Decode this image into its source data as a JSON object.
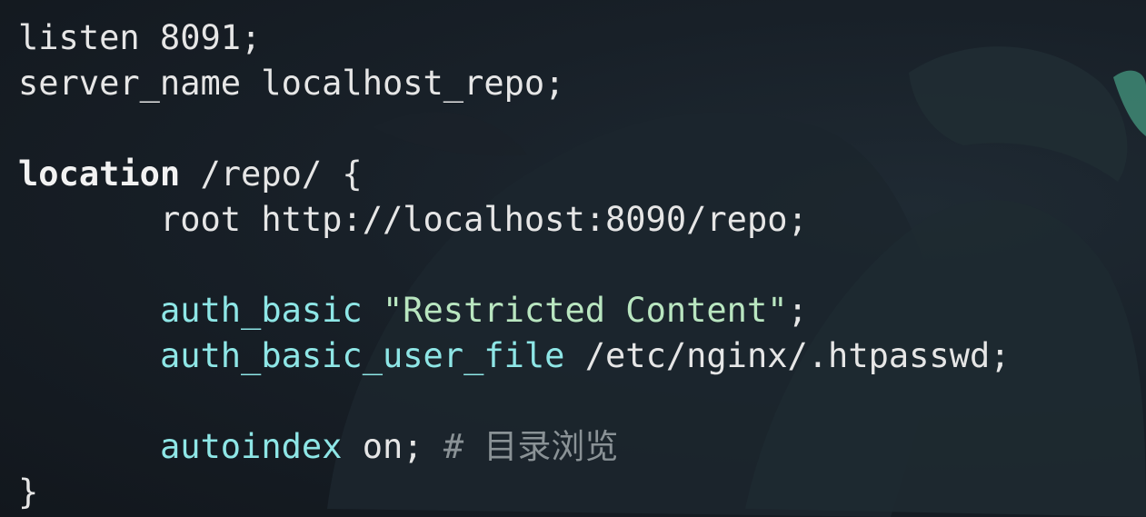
{
  "code": {
    "line1": "listen 8091;",
    "line2": "server_name localhost_repo;",
    "line4_keyword": "location",
    "line4_rest": " /repo/ {",
    "line5_indent": "       ",
    "line5": "root http://localhost:8090/repo;",
    "line7_directive": "auth_basic",
    "line7_string": "\"Restricted Content\"",
    "line7_end": ";",
    "line8_directive": "auth_basic_user_file",
    "line8_rest": " /etc/nginx/.htpasswd;",
    "line10_directive": "autoindex",
    "line10_rest": " on; ",
    "line10_comment": "# 目录浏览",
    "line11": "}"
  },
  "colors": {
    "background": "#151a21",
    "text": "#e6e6e6",
    "directive": "#8ee6e6",
    "string": "#b9e6c0",
    "comment": "#8a9296"
  }
}
